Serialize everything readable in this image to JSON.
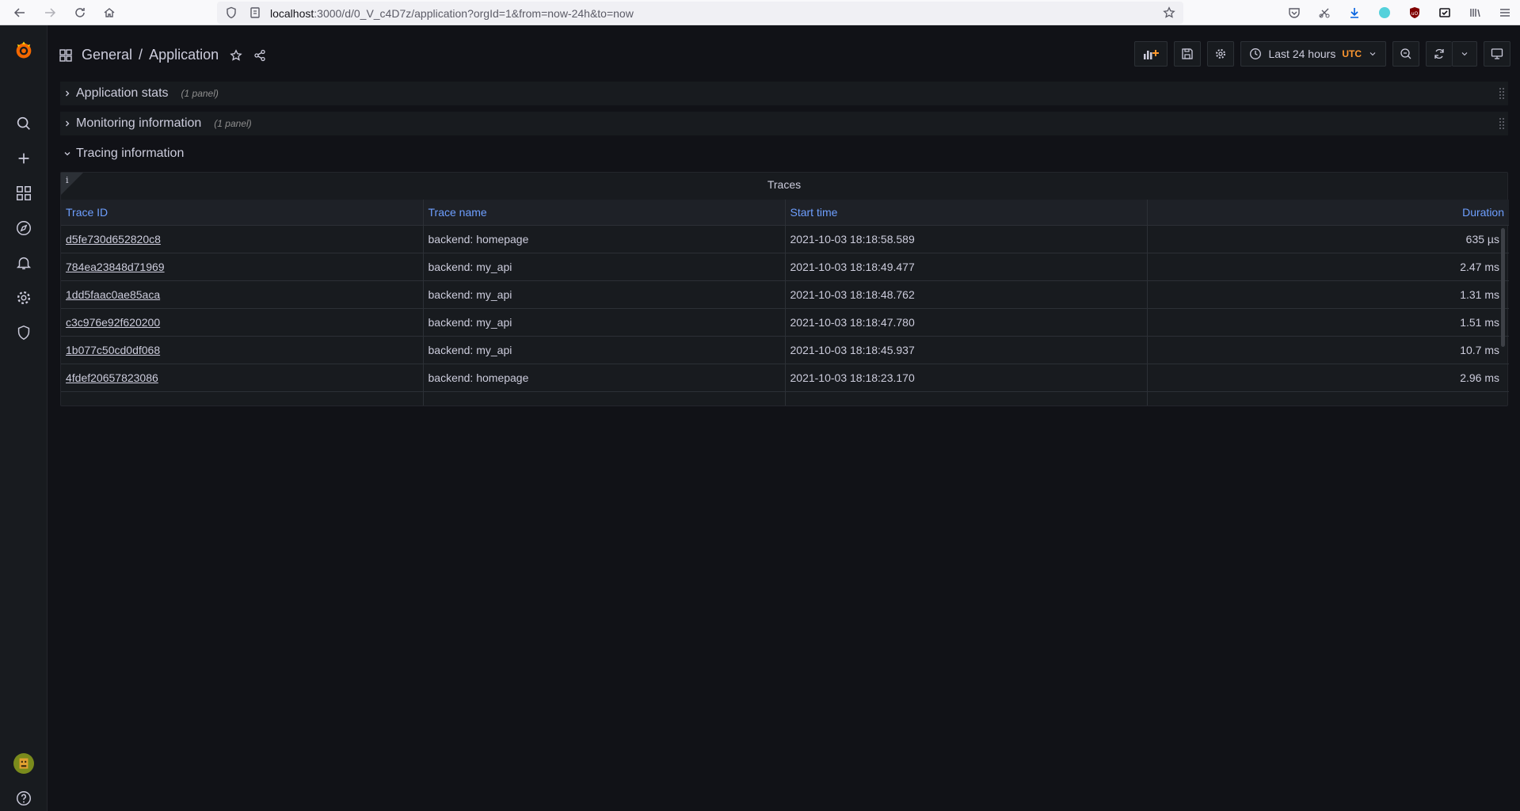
{
  "browser": {
    "url_host": "localhost",
    "url_rest": ":3000/d/0_V_c4D7z/application?orgId=1&from=now-24h&to=now"
  },
  "breadcrumb": {
    "folder": "General",
    "separator": "/",
    "dashboard": "Application"
  },
  "toolbar": {
    "time_range_label": "Last 24 hours",
    "timezone": "UTC"
  },
  "rows": [
    {
      "title": "Application stats",
      "count": "(1 panel)",
      "collapsed": true
    },
    {
      "title": "Monitoring information",
      "count": "(1 panel)",
      "collapsed": true
    },
    {
      "title": "Tracing information",
      "count": "",
      "collapsed": false
    }
  ],
  "panel": {
    "info_glyph": "i",
    "title": "Traces",
    "columns": [
      "Trace ID",
      "Trace name",
      "Start time",
      "Duration"
    ],
    "rows": [
      [
        "d5fe730d652820c8",
        "backend: homepage",
        "2021-10-03 18:18:58.589",
        "635 µs"
      ],
      [
        "784ea23848d71969",
        "backend: my_api",
        "2021-10-03 18:18:49.477",
        "2.47 ms"
      ],
      [
        "1dd5faac0ae85aca",
        "backend: my_api",
        "2021-10-03 18:18:48.762",
        "1.31 ms"
      ],
      [
        "c3c976e92f620200",
        "backend: my_api",
        "2021-10-03 18:18:47.780",
        "1.51 ms"
      ],
      [
        "1b077c50cd0df068",
        "backend: my_api",
        "2021-10-03 18:18:45.937",
        "10.7 ms"
      ],
      [
        "4fdef20657823086",
        "backend: homepage",
        "2021-10-03 18:18:23.170",
        "2.96 ms"
      ]
    ]
  },
  "colors": {
    "background": "#111217",
    "panel": "#181b1f",
    "link_header": "#6e9fff",
    "utc_accent": "#ff9830"
  },
  "icons": {
    "sidebar": [
      "grafana-logo-icon",
      "search-icon",
      "plus-icon",
      "dashboards-icon",
      "explore-compass-icon",
      "alerting-bell-icon",
      "gear-icon",
      "shield-icon",
      "user-avatar",
      "help-icon"
    ]
  }
}
